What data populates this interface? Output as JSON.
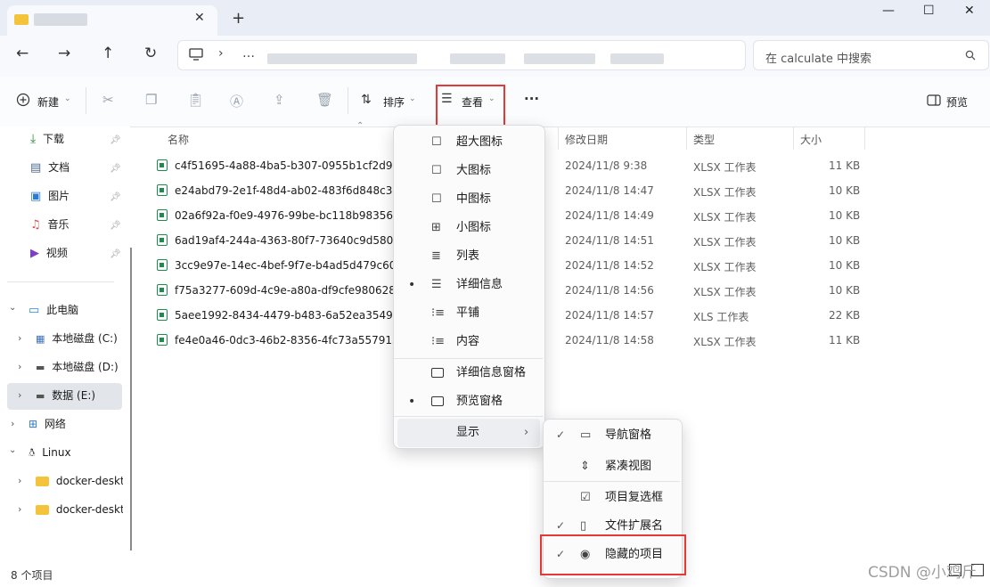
{
  "window": {
    "tab_icon": "folder-icon",
    "tab_close": "✕",
    "new_tab": "+",
    "minimize": "—",
    "maximize": "☐",
    "close": "✕"
  },
  "nav": {
    "back": "←",
    "forward": "→",
    "up": "↑",
    "refresh": "↻",
    "computer_icon": "monitor-icon",
    "chevron": "›",
    "ellipsis": "…"
  },
  "search": {
    "placeholder": "在 calculate 中搜索"
  },
  "toolbar": {
    "new_label": "新建",
    "sort_label": "排序",
    "view_label": "查看",
    "more_label": "···",
    "preview_label": "预览"
  },
  "sidebar": {
    "quick": [
      {
        "label": "下载",
        "icon": "download-icon"
      },
      {
        "label": "文档",
        "icon": "document-icon"
      },
      {
        "label": "图片",
        "icon": "picture-icon"
      },
      {
        "label": "音乐",
        "icon": "music-icon"
      },
      {
        "label": "视频",
        "icon": "video-icon"
      }
    ],
    "this_pc": "此电脑",
    "drives": [
      "本地磁盘 (C:)",
      "本地磁盘 (D:)",
      "数据 (E:)"
    ],
    "network": "网络",
    "linux": "Linux",
    "linux_children": [
      "docker-deskt",
      "docker-deskt"
    ]
  },
  "columns": {
    "name": "名称",
    "date": "修改日期",
    "type": "类型",
    "size": "大小"
  },
  "files": [
    {
      "name": "c4f51695-4a88-4ba5-b307-0955b1cf2d95_",
      "date": "2024/11/8 9:38",
      "type": "XLSX 工作表",
      "size": "11 KB"
    },
    {
      "name": "e24abd79-2e1f-48d4-ab02-483f6d848c34_",
      "date": "2024/11/8 14:47",
      "type": "XLSX 工作表",
      "size": "10 KB"
    },
    {
      "name": "02a6f92a-f0e9-4976-99be-bc118b98356e_",
      "date": "2024/11/8 14:49",
      "type": "XLSX 工作表",
      "size": "10 KB"
    },
    {
      "name": "6ad19af4-244a-4363-80f7-73640c9d580c_",
      "date": "2024/11/8 14:51",
      "type": "XLSX 工作表",
      "size": "10 KB"
    },
    {
      "name": "3cc9e97e-14ec-4bef-9f7e-b4ad5d479c60_",
      "date": "2024/11/8 14:52",
      "type": "XLSX 工作表",
      "size": "10 KB"
    },
    {
      "name": "f75a3277-609d-4c9e-a80a-df9cfe980628_",
      "date": "2024/11/8 14:56",
      "type": "XLSX 工作表",
      "size": "10 KB"
    },
    {
      "name": "5aee1992-8434-4479-b483-6a52ea354911",
      "date": "2024/11/8 14:57",
      "type": "XLS 工作表",
      "size": "22 KB"
    },
    {
      "name": "fe4e0a46-0dc3-46b2-8356-4fc73a557915_",
      "date": "2024/11/8 14:58",
      "type": "XLSX 工作表",
      "size": "11 KB"
    }
  ],
  "view_menu": {
    "items": [
      "超大图标",
      "大图标",
      "中图标",
      "小图标",
      "列表",
      "详细信息",
      "平铺",
      "内容"
    ],
    "panes": [
      "详细信息窗格",
      "预览窗格"
    ],
    "show": "显示",
    "bullet": "•",
    "arrow": "›"
  },
  "show_menu": {
    "items": [
      "导航窗格",
      "紧凑视图",
      "项目复选框",
      "文件扩展名",
      "隐藏的项目"
    ],
    "check": "✓"
  },
  "status": {
    "count": "8 个项目"
  },
  "watermark": "CSDN @小鸡斤"
}
